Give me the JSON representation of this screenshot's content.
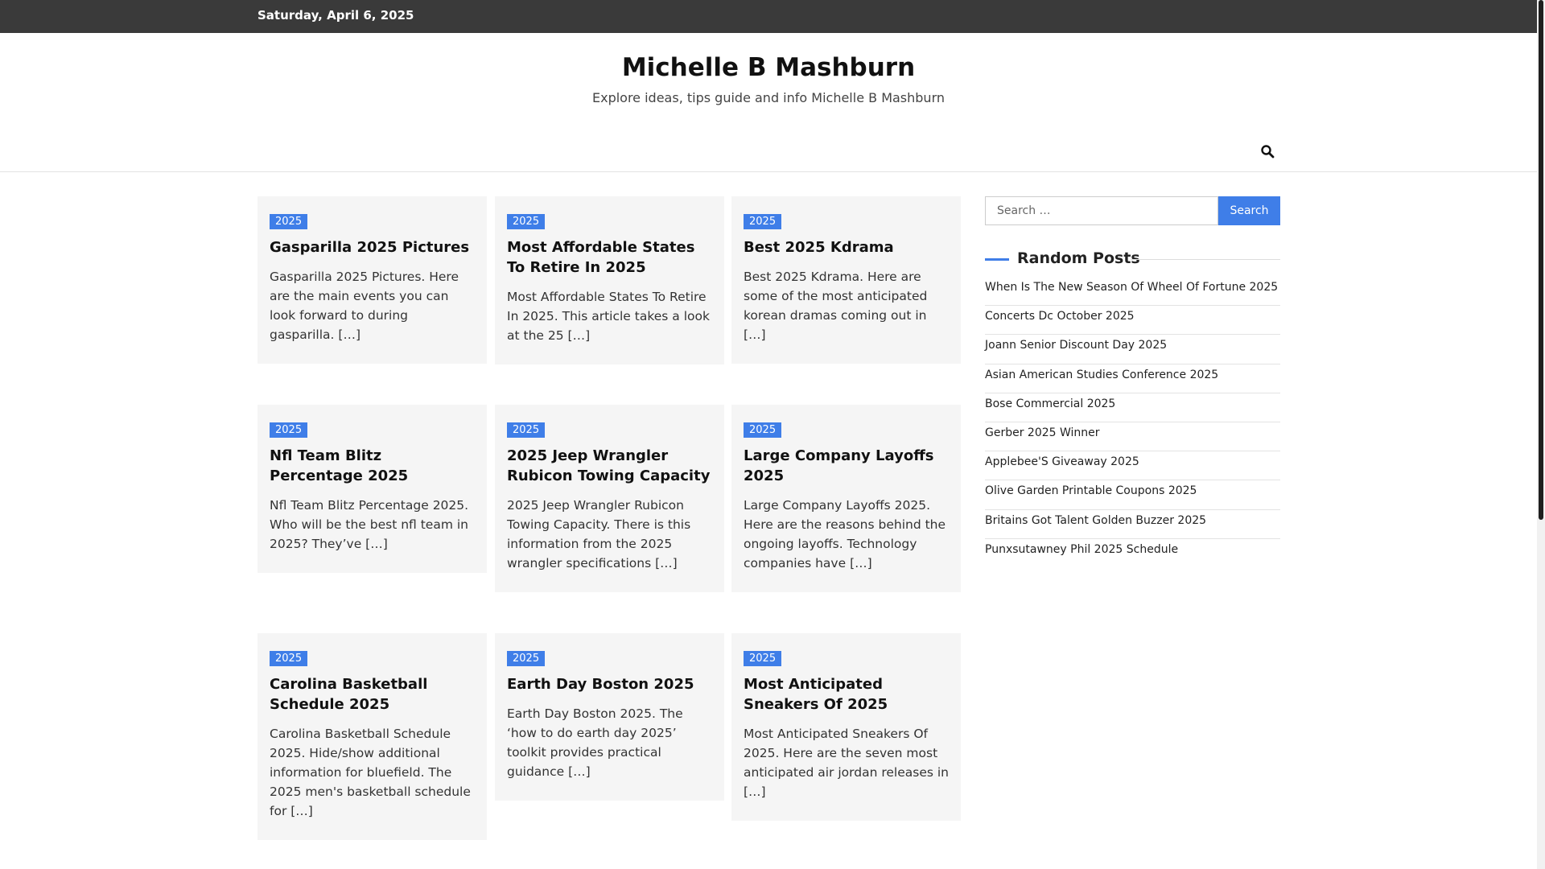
{
  "topbar": {
    "date": "Saturday, April 6, 2025"
  },
  "header": {
    "title": "Michelle B Mashburn",
    "description": "Explore ideas, tips guide and info Michelle B Mashburn",
    "search_icon": "search-icon"
  },
  "posts": [
    {
      "category": "2025",
      "title": "Gasparilla 2025 Pictures",
      "excerpt": "Gasparilla 2025 Pictures. Here are the main events you can look forward to during gasparilla. […]"
    },
    {
      "category": "2025",
      "title": "Most Affordable States To Retire In 2025",
      "excerpt": "Most Affordable States To Retire In 2025. This article takes a look at the 25 […]"
    },
    {
      "category": "2025",
      "title": "Best 2025 Kdrama",
      "excerpt": "Best 2025 Kdrama. Here are some of the most anticipated korean dramas coming out in […]"
    },
    {
      "category": "2025",
      "title": "Nfl Team Blitz Percentage 2025",
      "excerpt": "Nfl Team Blitz Percentage 2025. Who will be the best nfl team in 2025? They’ve […]"
    },
    {
      "category": "2025",
      "title": "2025 Jeep Wrangler Rubicon Towing Capacity",
      "excerpt": "2025 Jeep Wrangler Rubicon Towing Capacity. There is this information from the 2025 wrangler specifications […]"
    },
    {
      "category": "2025",
      "title": "Large Company Layoffs 2025",
      "excerpt": "Large Company Layoffs 2025. Here are the reasons behind the ongoing layoffs. Technology companies have […]"
    },
    {
      "category": "2025",
      "title": "Carolina Basketball Schedule 2025",
      "excerpt": "Carolina Basketball Schedule 2025. Hide/show additional information for bluefield. The 2025 men's basketball schedule for […]"
    },
    {
      "category": "2025",
      "title": "Earth Day Boston 2025",
      "excerpt": "Earth Day Boston 2025. The ‘how to do earth day 2025’ toolkit provides practical guidance […]"
    },
    {
      "category": "2025",
      "title": "Most Anticipated Sneakers Of 2025",
      "excerpt": "Most Anticipated Sneakers Of 2025. Here are the seven most anticipated air jordan releases in […]"
    }
  ],
  "sidebar": {
    "search": {
      "placeholder": "Search …",
      "button_label": "Search"
    },
    "widget_title": "Random Posts",
    "random_posts": [
      "When Is The New Season Of Wheel Of Fortune 2025",
      "Concerts Dc October 2025",
      "Joann Senior Discount Day 2025",
      "Asian American Studies Conference 2025",
      "Bose Commercial 2025",
      "Gerber 2025 Winner",
      "Applebee'S Giveaway 2025",
      "Olive Garden Printable Coupons 2025",
      "Britains Got Talent Golden Buzzer 2025",
      "Punxsutawney Phil 2025 Schedule"
    ]
  },
  "colors": {
    "accent": "#3f7ee8",
    "topbar": "#3a3a3a",
    "card_bg": "#f5f5f5"
  }
}
